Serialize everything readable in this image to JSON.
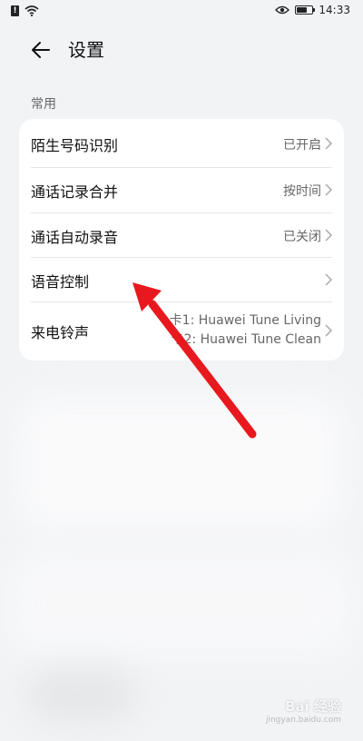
{
  "status_bar": {
    "time": "14:33",
    "sim_badge": "!",
    "icons": [
      "sim-alert-icon",
      "wifi-icon",
      "eye-icon",
      "battery-icon"
    ],
    "battery_level": 0.7
  },
  "header": {
    "title": "设置",
    "back_icon": "arrow-left-icon"
  },
  "section": {
    "label": "常用"
  },
  "rows": [
    {
      "label": "陌生号码识别",
      "value": "已开启"
    },
    {
      "label": "通话记录合并",
      "value": "按时间"
    },
    {
      "label": "通话自动录音",
      "value": "已关闭"
    },
    {
      "label": "语音控制",
      "value": ""
    },
    {
      "label": "来电铃声",
      "value_line1": "卡1: Huawei Tune Living",
      "value_line2": "卡2: Huawei Tune Clean"
    }
  ],
  "annotation": {
    "type": "red-arrow",
    "color": "#e8191e"
  },
  "watermark": {
    "brand": "Bai 经验",
    "url": "jingyan.baidu.com"
  }
}
